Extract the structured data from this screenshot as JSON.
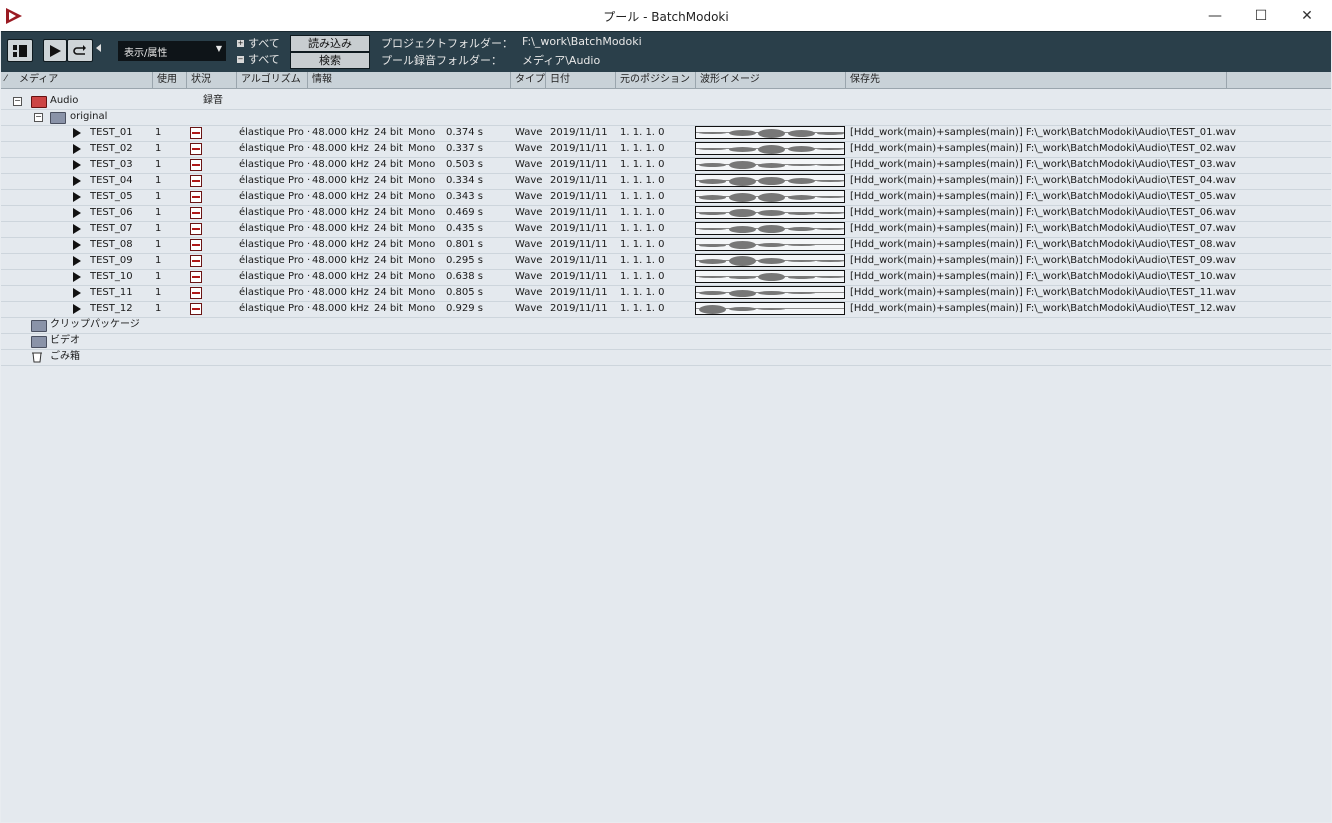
{
  "window": {
    "title": "プール - BatchModoki",
    "minimize": "—",
    "maximize": "☐",
    "close": "✕"
  },
  "toolbar": {
    "view_select": "表示/属性",
    "expand_all": "すべて",
    "collapse_all": "すべて",
    "import_button": "読み込み",
    "search_button": "検索",
    "project_folder_label": "プロジェクトフォルダー：",
    "project_folder_value": "F:\\_work\\BatchModoki",
    "pool_record_label": "プール録音フォルダー：",
    "pool_record_value": "メディア\\Audio"
  },
  "columns": [
    "メディア",
    "使用",
    "状況",
    "アルゴリズム",
    "情報",
    "タイプ",
    "日付",
    "元のポジション",
    "波形イメージ",
    "保存先"
  ],
  "tree": {
    "audio_folder": "Audio",
    "audio_status": "録音",
    "original_folder": "original",
    "clip_package": "クリップパッケージ",
    "video": "ビデオ",
    "trash": "ごみ箱"
  },
  "files": [
    {
      "name": "TEST_01",
      "used": "1",
      "algorithm": "élastique Pro ·",
      "rate": "48.000 kHz",
      "bits": "24 bit",
      "channels": "Mono",
      "length": "0.374 s",
      "type": "Wave",
      "date": "2019/11/11",
      "position": "1. 1. 1.  0",
      "path": "[Hdd_work(main)+samples(main)] F:\\_work\\BatchModoki\\Audio\\TEST_01.wav",
      "wave": [
        0.2,
        0.55,
        0.85,
        0.7,
        0.3
      ]
    },
    {
      "name": "TEST_02",
      "used": "1",
      "algorithm": "élastique Pro ·",
      "rate": "48.000 kHz",
      "bits": "24 bit",
      "channels": "Mono",
      "length": "0.337 s",
      "type": "Wave",
      "date": "2019/11/11",
      "position": "1. 1. 1.  0",
      "path": "[Hdd_work(main)+samples(main)] F:\\_work\\BatchModoki\\Audio\\TEST_02.wav",
      "wave": [
        0.15,
        0.5,
        0.9,
        0.6,
        0.2
      ]
    },
    {
      "name": "TEST_03",
      "used": "1",
      "algorithm": "élastique Pro ·",
      "rate": "48.000 kHz",
      "bits": "24 bit",
      "channels": "Mono",
      "length": "0.503 s",
      "type": "Wave",
      "date": "2019/11/11",
      "position": "1. 1. 1.  0",
      "path": "[Hdd_work(main)+samples(main)] F:\\_work\\BatchModoki\\Audio\\TEST_03.wav",
      "wave": [
        0.4,
        0.8,
        0.5,
        0.2,
        0.1
      ]
    },
    {
      "name": "TEST_04",
      "used": "1",
      "algorithm": "élastique Pro ·",
      "rate": "48.000 kHz",
      "bits": "24 bit",
      "channels": "Mono",
      "length": "0.334 s",
      "type": "Wave",
      "date": "2019/11/11",
      "position": "1. 1. 1.  0",
      "path": "[Hdd_work(main)+samples(main)] F:\\_work\\BatchModoki\\Audio\\TEST_04.wav",
      "wave": [
        0.5,
        0.9,
        0.8,
        0.6,
        0.2
      ]
    },
    {
      "name": "TEST_05",
      "used": "1",
      "algorithm": "élastique Pro ·",
      "rate": "48.000 kHz",
      "bits": "24 bit",
      "channels": "Mono",
      "length": "0.343 s",
      "type": "Wave",
      "date": "2019/11/11",
      "position": "1. 1. 1.  0",
      "path": "[Hdd_work(main)+samples(main)] F:\\_work\\BatchModoki\\Audio\\TEST_05.wav",
      "wave": [
        0.5,
        0.9,
        0.85,
        0.5,
        0.15
      ]
    },
    {
      "name": "TEST_06",
      "used": "1",
      "algorithm": "élastique Pro ·",
      "rate": "48.000 kHz",
      "bits": "24 bit",
      "channels": "Mono",
      "length": "0.469 s",
      "type": "Wave",
      "date": "2019/11/11",
      "position": "1. 1. 1.  0",
      "path": "[Hdd_work(main)+samples(main)] F:\\_work\\BatchModoki\\Audio\\TEST_06.wav",
      "wave": [
        0.3,
        0.8,
        0.6,
        0.3,
        0.1
      ]
    },
    {
      "name": "TEST_07",
      "used": "1",
      "algorithm": "élastique Pro ·",
      "rate": "48.000 kHz",
      "bits": "24 bit",
      "channels": "Mono",
      "length": "0.435 s",
      "type": "Wave",
      "date": "2019/11/11",
      "position": "1. 1. 1.  0",
      "path": "[Hdd_work(main)+samples(main)] F:\\_work\\BatchModoki\\Audio\\TEST_07.wav",
      "wave": [
        0.2,
        0.7,
        0.8,
        0.4,
        0.1
      ]
    },
    {
      "name": "TEST_08",
      "used": "1",
      "algorithm": "élastique Pro ·",
      "rate": "48.000 kHz",
      "bits": "24 bit",
      "channels": "Mono",
      "length": "0.801 s",
      "type": "Wave",
      "date": "2019/11/11",
      "position": "1. 1. 1.  0",
      "path": "[Hdd_work(main)+samples(main)] F:\\_work\\BatchModoki\\Audio\\TEST_08.wav",
      "wave": [
        0.3,
        0.75,
        0.4,
        0.15,
        0.05
      ]
    },
    {
      "name": "TEST_09",
      "used": "1",
      "algorithm": "élastique Pro ·",
      "rate": "48.000 kHz",
      "bits": "24 bit",
      "channels": "Mono",
      "length": "0.295 s",
      "type": "Wave",
      "date": "2019/11/11",
      "position": "1. 1. 1.  0",
      "path": "[Hdd_work(main)+samples(main)] F:\\_work\\BatchModoki\\Audio\\TEST_09.wav",
      "wave": [
        0.5,
        0.95,
        0.6,
        0.2,
        0.1
      ]
    },
    {
      "name": "TEST_10",
      "used": "1",
      "algorithm": "élastique Pro ·",
      "rate": "48.000 kHz",
      "bits": "24 bit",
      "channels": "Mono",
      "length": "0.638 s",
      "type": "Wave",
      "date": "2019/11/11",
      "position": "1. 1. 1.  0",
      "path": "[Hdd_work(main)+samples(main)] F:\\_work\\BatchModoki\\Audio\\TEST_10.wav",
      "wave": [
        0.1,
        0.3,
        0.8,
        0.3,
        0.1
      ]
    },
    {
      "name": "TEST_11",
      "used": "1",
      "algorithm": "élastique Pro ·",
      "rate": "48.000 kHz",
      "bits": "24 bit",
      "channels": "Mono",
      "length": "0.805 s",
      "type": "Wave",
      "date": "2019/11/11",
      "position": "1. 1. 1.  0",
      "path": "[Hdd_work(main)+samples(main)] F:\\_work\\BatchModoki\\Audio\\TEST_11.wav",
      "wave": [
        0.4,
        0.7,
        0.4,
        0.15,
        0.05
      ]
    },
    {
      "name": "TEST_12",
      "used": "1",
      "algorithm": "élastique Pro ·",
      "rate": "48.000 kHz",
      "bits": "24 bit",
      "channels": "Mono",
      "length": "0.929 s",
      "type": "Wave",
      "date": "2019/11/11",
      "position": "1. 1. 1.  0",
      "path": "[Hdd_work(main)+samples(main)] F:\\_work\\BatchModoki\\Audio\\TEST_12.wav",
      "wave": [
        0.9,
        0.4,
        0.15,
        0.05,
        0.02
      ]
    }
  ],
  "colors": {
    "toolbar_bg": "#2a3f4a",
    "header_bg": "#c9d2d8",
    "content_bg": "#e4e9ee",
    "status_red": "#b01818"
  }
}
